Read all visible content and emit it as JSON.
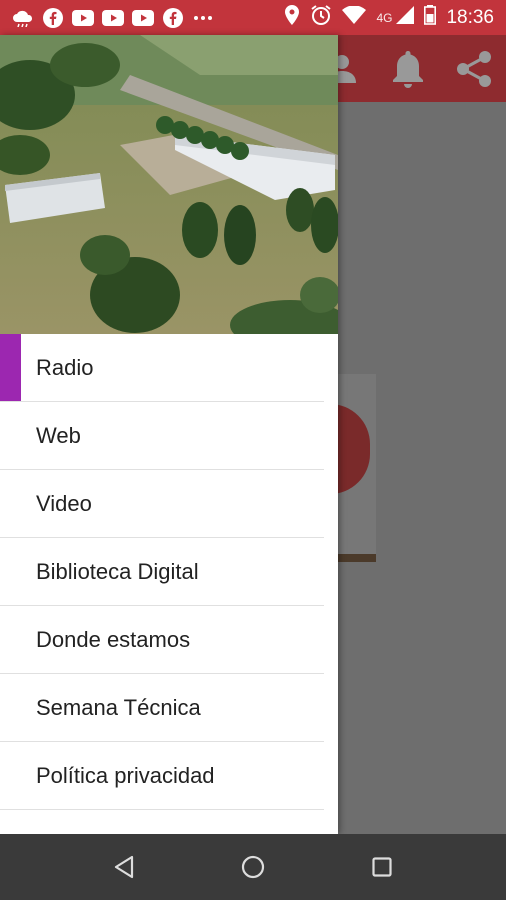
{
  "status_bar": {
    "time": "18:36",
    "network_type": "4G",
    "notification_icons": [
      "cloud-icon",
      "facebook-icon",
      "youtube-icon",
      "youtube-icon",
      "youtube-icon",
      "facebook-icon",
      "more-icon"
    ],
    "system_icons": [
      "location-icon",
      "alarm-icon",
      "wifi-icon",
      "signal-icon",
      "battery-icon"
    ]
  },
  "app_bar": {
    "icons": [
      "person-icon",
      "bell-icon",
      "share-icon"
    ],
    "color": "#c2343c"
  },
  "drawer": {
    "menu_items": [
      {
        "label": "Radio",
        "active": true
      },
      {
        "label": "Web",
        "active": false
      },
      {
        "label": "Video",
        "active": false
      },
      {
        "label": "Biblioteca Digital",
        "active": false
      },
      {
        "label": "Donde estamos",
        "active": false
      },
      {
        "label": "Semana Técnica",
        "active": false
      },
      {
        "label": "Política privacidad",
        "active": false
      }
    ],
    "active_accent": "#9c27b0"
  },
  "nav_bar": {
    "buttons": [
      "back-icon",
      "home-icon",
      "recents-icon"
    ]
  }
}
